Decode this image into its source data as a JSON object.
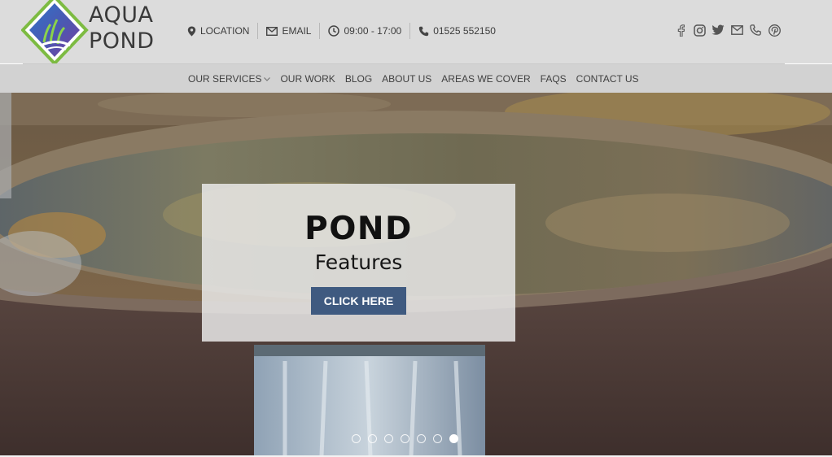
{
  "brand": {
    "line1": "AQUA",
    "line2": "POND"
  },
  "header": {
    "contacts": [
      {
        "icon": "location-pin-icon",
        "label": "LOCATION"
      },
      {
        "icon": "envelope-icon",
        "label": "EMAIL"
      },
      {
        "icon": "clock-icon",
        "label": "09:00 - 17:00"
      },
      {
        "icon": "phone-icon",
        "label": "01525 552150"
      }
    ],
    "social": [
      "facebook-icon",
      "instagram-icon",
      "twitter-icon",
      "email-icon",
      "phone-icon",
      "pinterest-icon"
    ]
  },
  "nav": {
    "items": [
      "OUR SERVICES",
      "OUR WORK",
      "BLOG",
      "ABOUT US",
      "AREAS WE COVER",
      "FAQS",
      "CONTACT US"
    ]
  },
  "hero": {
    "title": "POND",
    "subtitle": "Features",
    "cta": "CLICK HERE",
    "slide_count": 7,
    "active_slide": 7
  },
  "colors": {
    "header_bg": "#dcdcdc",
    "nav_bg": "#d2d2d2",
    "cta_bg": "#3f5a80",
    "logo_green": "#6db33f",
    "logo_blue": "#3f5aa8"
  }
}
